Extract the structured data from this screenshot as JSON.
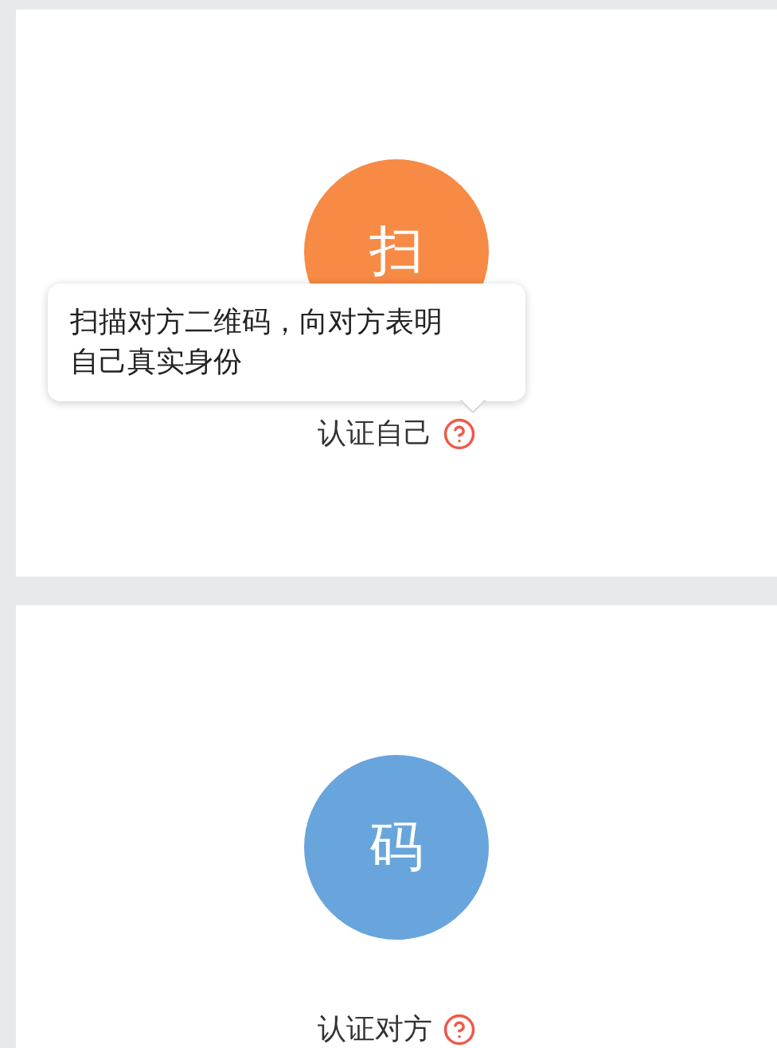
{
  "cards": [
    {
      "avatar": "扫",
      "color": "#f78a45",
      "label": "认证自己",
      "tooltip": "扫描对方二维码，向对方表明自己真实身份"
    },
    {
      "avatar": "码",
      "color": "#68a5dc",
      "label": "认证对方"
    }
  ]
}
